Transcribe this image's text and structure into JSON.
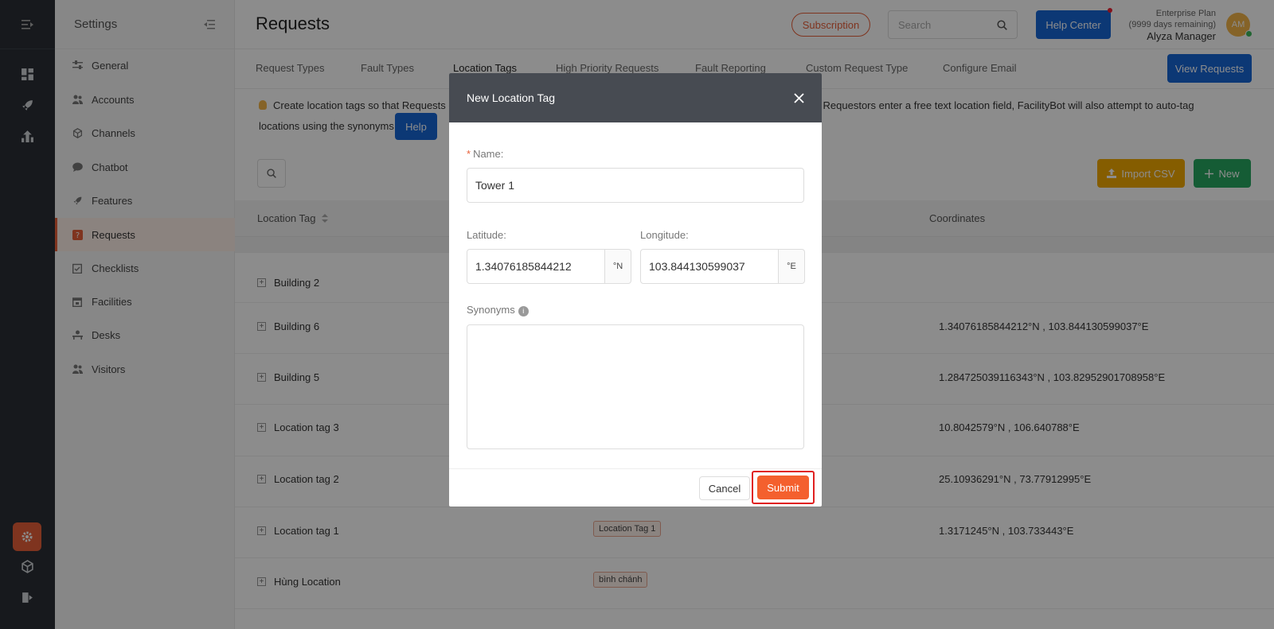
{
  "sidebar": {
    "title": "Settings",
    "items": [
      {
        "label": "General",
        "icon": "sliders-icon"
      },
      {
        "label": "Accounts",
        "icon": "users-icon"
      },
      {
        "label": "Channels",
        "icon": "cube-icon"
      },
      {
        "label": "Chatbot",
        "icon": "chat-icon"
      },
      {
        "label": "Features",
        "icon": "rocket-icon"
      },
      {
        "label": "Requests",
        "icon": "question-icon"
      },
      {
        "label": "Checklists",
        "icon": "checklist-icon"
      },
      {
        "label": "Facilities",
        "icon": "calendar-icon"
      },
      {
        "label": "Desks",
        "icon": "desk-icon"
      },
      {
        "label": "Visitors",
        "icon": "visitor-icon"
      }
    ],
    "active_index": 5
  },
  "header": {
    "title": "Requests",
    "subscription_label": "Subscription",
    "search_placeholder": "Search",
    "help_center_label": "Help Center",
    "plan_name": "Enterprise Plan",
    "plan_remaining": "(9999 days remaining)",
    "user_name": "Alyza Manager",
    "avatar_initials": "AM"
  },
  "tabs": [
    {
      "label": "Request Types"
    },
    {
      "label": "Fault Types"
    },
    {
      "label": "Location Tags"
    },
    {
      "label": "High Priority Requests"
    },
    {
      "label": "Fault Reporting"
    },
    {
      "label": "Custom Request Type"
    },
    {
      "label": "Configure Email"
    }
  ],
  "view_requests_label": "View Requests",
  "info": {
    "text_before": "Create location tags so that Requests c",
    "text_after": "s. Where Requestors enter a free text location field, FacilityBot will also attempt to auto-tag",
    "text_line2": "locations using the synonyms.",
    "help_label": "Help"
  },
  "toolbar": {
    "import_label": "Import CSV",
    "new_label": "New"
  },
  "table": {
    "headers": {
      "location_tag": "Location Tag",
      "coordinates": "Coordinates"
    },
    "rows": [
      {
        "name": "Building 2",
        "synonym": "",
        "coords": ""
      },
      {
        "name": "Building 6",
        "synonym": "",
        "coords": "1.34076185844212°N , 103.844130599037°E"
      },
      {
        "name": "Building 5",
        "synonym": "",
        "coords": "1.284725039116343°N , 103.82952901708958°E"
      },
      {
        "name": "Location tag 3",
        "synonym": "",
        "coords": "10.8042579°N , 106.640788°E"
      },
      {
        "name": "Location tag 2",
        "synonym": "",
        "coords": "25.10936291°N , 73.77912995°E"
      },
      {
        "name": "Location tag 1",
        "synonym": "Location Tag 1",
        "coords": "1.3171245°N , 103.733443°E"
      },
      {
        "name": "Hùng Location",
        "synonym": "bình chánh",
        "coords": ""
      }
    ]
  },
  "modal": {
    "title": "New Location Tag",
    "name_label": "Name",
    "name_value": "Tower 1",
    "latitude_label": "Latitude",
    "latitude_value": "1.34076185844212",
    "latitude_suffix": "°N",
    "longitude_label": "Longitude",
    "longitude_value": "103.844130599037",
    "longitude_suffix": "°E",
    "synonyms_label": "Synonyms",
    "cancel_label": "Cancel",
    "submit_label": "Submit"
  },
  "colors": {
    "accent": "#e8603a",
    "primary": "#1766d6",
    "rail": "#2b2f35",
    "modal_header": "#474b52"
  }
}
